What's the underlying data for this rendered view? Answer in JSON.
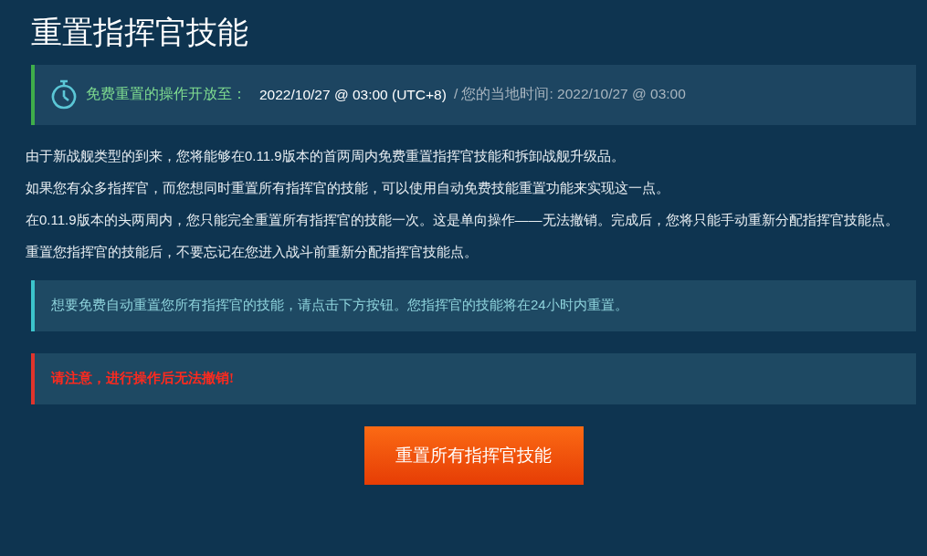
{
  "title": "重置指挥官技能",
  "timer": {
    "label": "免费重置的操作开放至：",
    "server_time": "2022/10/27 @ 03:00 (UTC+8)",
    "local_time": "/ 您的当地时间: 2022/10/27 @ 03:00"
  },
  "paragraphs": [
    "由于新战舰类型的到来，您将能够在0.11.9版本的首两周内免费重置指挥官技能和拆卸战舰升级品。",
    "如果您有众多指挥官，而您想同时重置所有指挥官的技能，可以使用自动免费技能重置功能来实现这一点。",
    "在0.11.9版本的头两周内，您只能完全重置所有指挥官的技能一次。这是单向操作——无法撤销。完成后，您将只能手动重新分配指挥官技能点。",
    "重置您指挥官的技能后，不要忘记在您进入战斗前重新分配指挥官技能点。"
  ],
  "notices": [
    {
      "kind": "info",
      "text": "想要免费自动重置您所有指挥官的技能，请点击下方按钮。您指挥官的技能将在24小时内重置。",
      "color": "#3cc4cc"
    },
    {
      "kind": "warning",
      "text": "请注意，进行操作后无法撤销!",
      "color": "#e0342c"
    }
  ],
  "button": {
    "label": "重置所有指挥官技能"
  }
}
